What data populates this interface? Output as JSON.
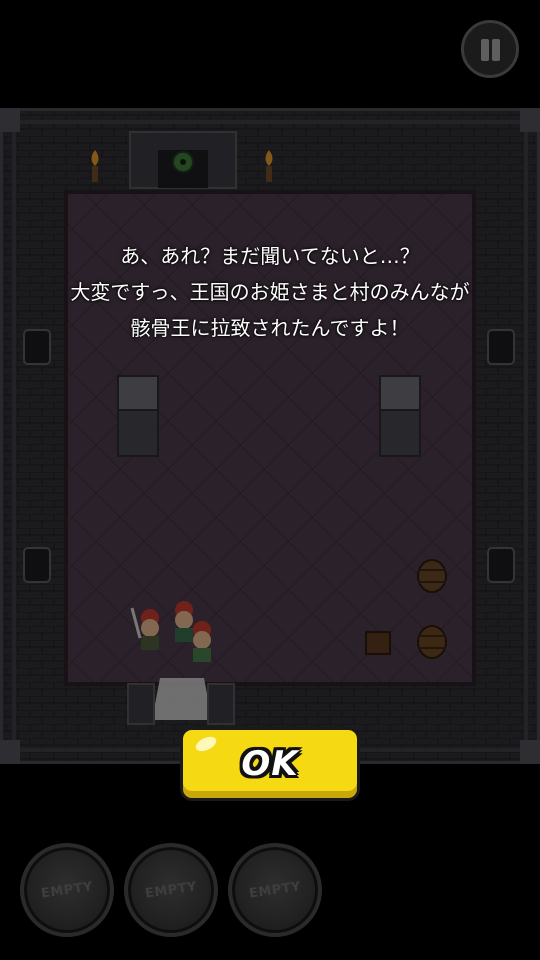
{
  "dialog": {
    "lines": [
      "あ、あれ？まだ聞いてないと…？",
      "大変ですっ、王国のお姫さまと村のみんなが",
      "骸骨王に拉致されたんですよ！"
    ]
  },
  "ok_button": {
    "label": "OK"
  },
  "item_slots": [
    {
      "label": "EMPTY"
    },
    {
      "label": "EMPTY"
    },
    {
      "label": "EMPTY"
    }
  ],
  "colors": {
    "ok_yellow": "#f5d912",
    "floor": "#4a3a48",
    "wall": "#2f2e33"
  }
}
